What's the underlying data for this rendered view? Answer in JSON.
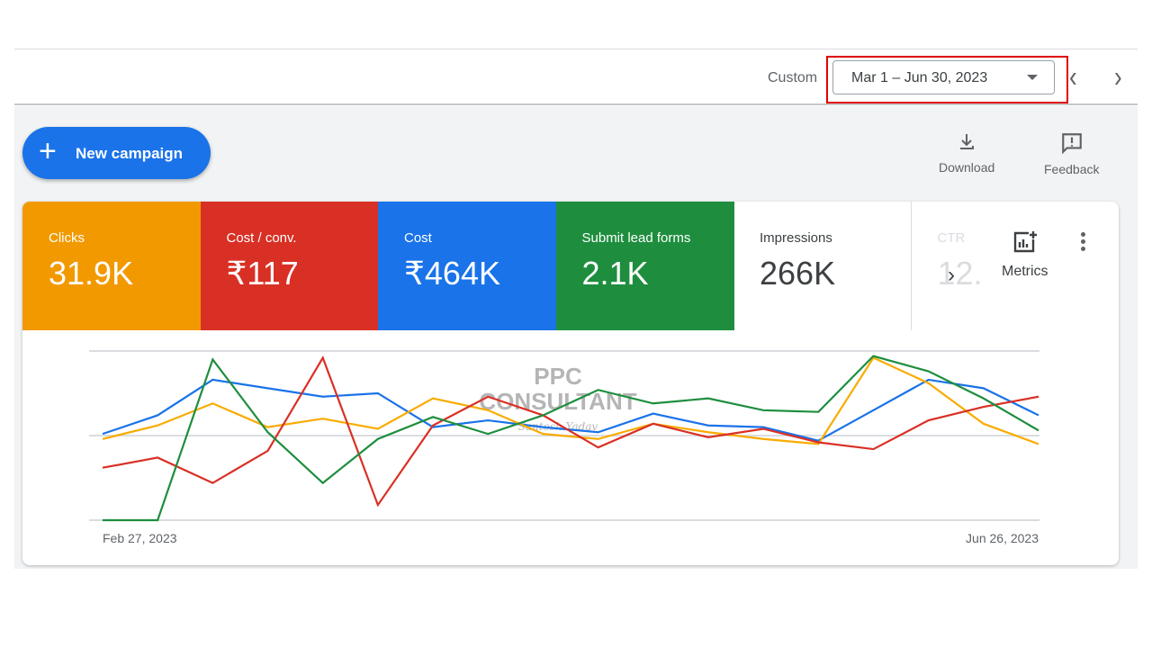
{
  "header": {
    "date_preset": "Custom",
    "date_range": "Mar 1 – Jun 30, 2023",
    "prev_icon": "chevron-left-icon",
    "next_icon": "chevron-right-icon",
    "highlight_color": "#e00000"
  },
  "toolbar": {
    "new_campaign": "New campaign",
    "download": "Download",
    "feedback": "Feedback"
  },
  "metrics": [
    {
      "title": "Clicks",
      "value": "31.9K",
      "color": "#f29900"
    },
    {
      "title": "Cost / conv.",
      "value": "₹117",
      "color": "#d93025"
    },
    {
      "title": "Cost",
      "value": "₹464K",
      "color": "#1a73e8"
    },
    {
      "title": "Submit lead forms",
      "value": "2.1K",
      "color": "#1e8e3e"
    },
    {
      "title": "Impressions",
      "value": "266K",
      "color": "#ffffff"
    },
    {
      "title": "CTR",
      "value": "12.",
      "color": "#ffffff"
    }
  ],
  "metrics_button": "Metrics",
  "watermark": {
    "line1": "PPC",
    "line2": "CONSULTANT",
    "line3": "Santosh Yadav"
  },
  "chart_data": {
    "type": "line",
    "x_start_label": "Feb 27, 2023",
    "x_end_label": "Jun 26, 2023",
    "ylim": [
      0,
      100
    ],
    "grid": true,
    "series": [
      {
        "color": "#1a73e8",
        "values": [
          51,
          62,
          83,
          78,
          73,
          75,
          55,
          59,
          55,
          52,
          63,
          56,
          55,
          47,
          65,
          83,
          78,
          62
        ]
      },
      {
        "color": "#f9ab00",
        "values": [
          48,
          56,
          69,
          55,
          60,
          54,
          72,
          65,
          51,
          48,
          57,
          52,
          48,
          45,
          96,
          81,
          57,
          45
        ]
      },
      {
        "color": "#d93025",
        "values": [
          31,
          37,
          22,
          41,
          96,
          9,
          56,
          73,
          62,
          43,
          57,
          49,
          54,
          46,
          42,
          59,
          67,
          73
        ]
      },
      {
        "color": "#1e8e3e",
        "values": [
          0,
          0,
          95,
          52,
          22,
          48,
          61,
          51,
          62,
          77,
          69,
          72,
          65,
          64,
          97,
          88,
          72,
          53
        ]
      }
    ]
  }
}
